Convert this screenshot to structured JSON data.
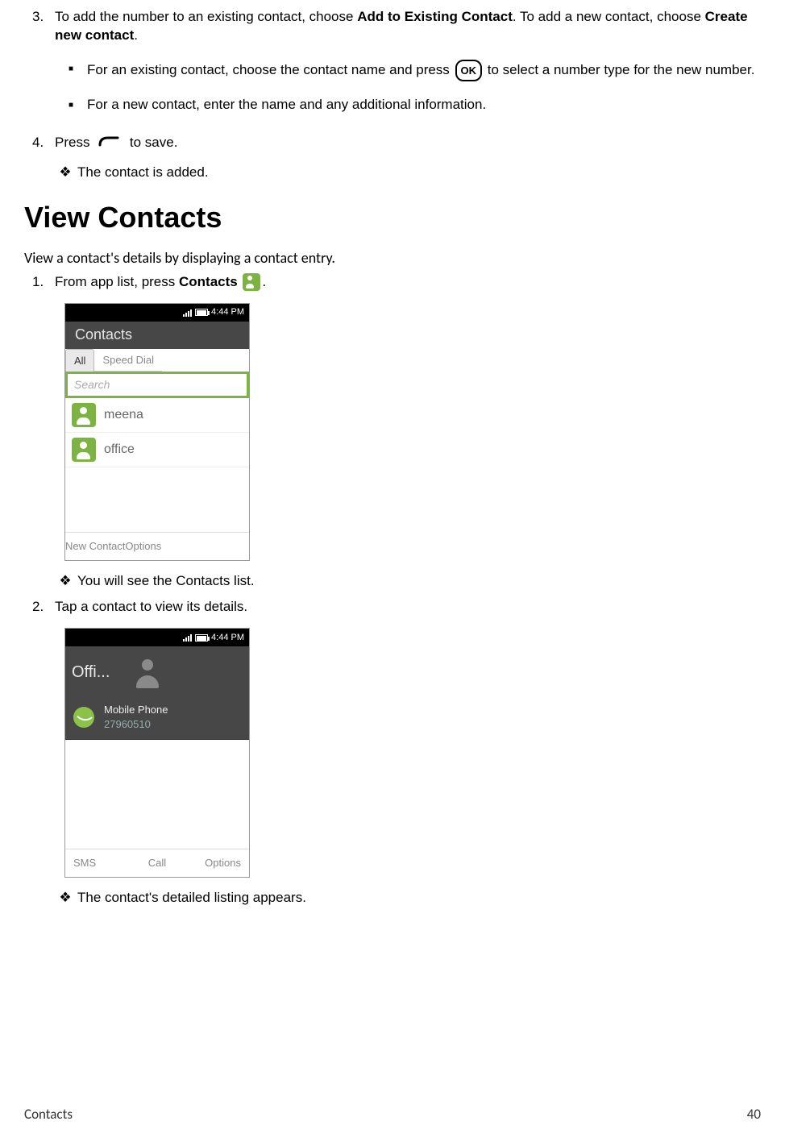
{
  "step3": {
    "marker": "3.",
    "t1": "To add the number to an existing contact, choose ",
    "b1": "Add to Existing Contact",
    "t2": ". To add a new contact, choose ",
    "b2": "Create new contact",
    "t3": "."
  },
  "step3_sub": {
    "a1": "For an existing contact, choose the contact name and press ",
    "ok": "OK",
    "a2": " to select a number type for the new number.",
    "b": "For a new contact, enter the name and any additional information."
  },
  "step4": {
    "marker": "4.",
    "t1": "Press ",
    "t2": " to save."
  },
  "step4_result": "The contact is added.",
  "heading": "View Contacts",
  "intro": "View a contact's details by displaying a contact entry.",
  "view1": {
    "marker": "1.",
    "t1": "From app list, press ",
    "b1": "Contacts",
    "t2": " ",
    "t3": "."
  },
  "view1_result": "You will see the Contacts list.",
  "view2": {
    "marker": "2.",
    "t": "Tap a contact to view its details."
  },
  "view2_result": "The contact's detailed listing appears.",
  "phone1": {
    "time": "4:44 PM",
    "title": "Contacts",
    "tabs": [
      "All",
      "Speed Dial"
    ],
    "search_placeholder": "Search",
    "rows": [
      "meena",
      "office"
    ],
    "softkeys": [
      "New Contact",
      "Options"
    ]
  },
  "phone2": {
    "time": "4:44 PM",
    "name": "Offi...",
    "phone_label": "Mobile Phone",
    "phone_number": "27960510",
    "softkeys": [
      "SMS",
      "Call",
      "Options"
    ]
  },
  "footer": {
    "left": "Contacts",
    "right": "40"
  }
}
